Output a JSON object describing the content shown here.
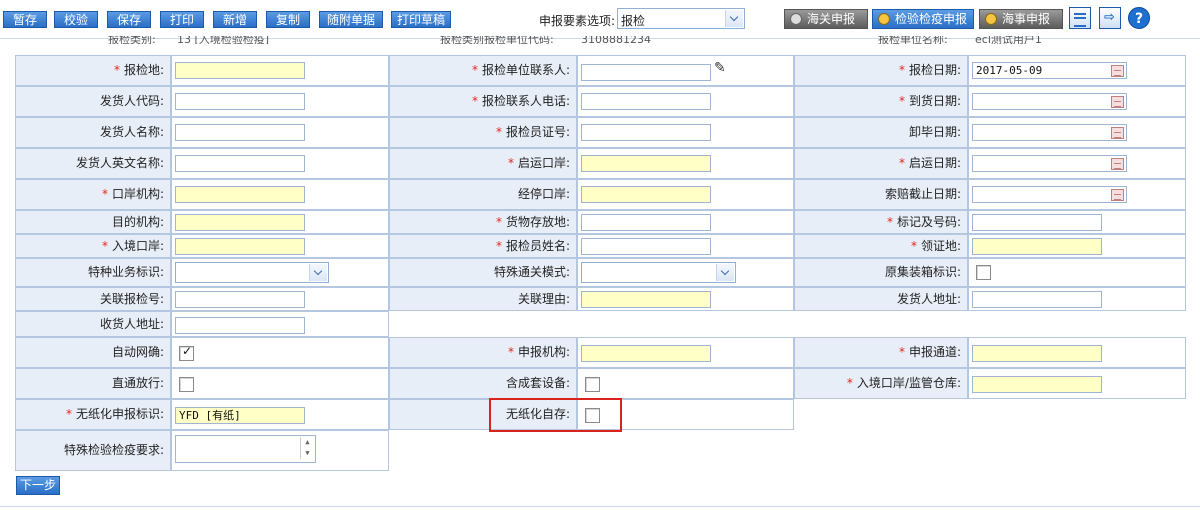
{
  "toolbar": {
    "buttons": [
      "暂存",
      "校验",
      "保存",
      "打印",
      "新增",
      "复制",
      "随附单据",
      "打印草稿"
    ],
    "select_label": "申报要素选项:",
    "select_value": "报检",
    "right_buttons": [
      "海关申报",
      "检验检疫申报",
      "海事申报"
    ],
    "help": "?"
  },
  "partial_row": [
    "报检类别:",
    "13 [入境检验检疫]",
    "报检类别报检单位代码:",
    "3108881234",
    "报检单位名称:",
    "ecl测试用户1"
  ],
  "fields": {
    "inspection_place": "报检地:",
    "inspection_contact": "报检单位联系人:",
    "inspection_date": "报检日期:",
    "inspection_date_value": "2017-05-09",
    "shipper_code": "发货人代码:",
    "contact_phone": "报检联系人电话:",
    "arrival_date": "到货日期:",
    "shipper_name": "发货人名称:",
    "inspector_cert": "报检员证号:",
    "unload_date": "卸毕日期:",
    "shipper_en_name": "发货人英文名称:",
    "departure_port": "启运口岸:",
    "departure_date": "启运日期:",
    "port_agency": "口岸机构:",
    "via_port": "经停口岸:",
    "claim_deadline": "索赔截止日期:",
    "dest_agency": "目的机构:",
    "storage_place": "货物存放地:",
    "marks": "标记及号码:",
    "entry_port": "入境口岸:",
    "inspector_name": "报检员姓名:",
    "cert_place": "领证地:",
    "special_business": "特种业务标识:",
    "special_clearance": "特殊通关模式:",
    "container_flag": "原集装箱标识:",
    "related_no": "关联报检号:",
    "related_reason": "关联理由:",
    "shipper_address": "发货人地址:",
    "consignee_address": "收货人地址:",
    "auto_net": "自动网确:",
    "declare_agency": "申报机构:",
    "declare_channel": "申报通道:",
    "direct_release": "直通放行:",
    "complete_set": "含成套设备:",
    "entry_warehouse": "入境口岸/监管仓库:",
    "paperless_flag": "无纸化申报标识:",
    "paperless_value": "YFD [有纸]",
    "paperless_self": "无纸化自存:",
    "special_requirements": "特殊检验检疫要求:"
  },
  "next_button": "下一步"
}
